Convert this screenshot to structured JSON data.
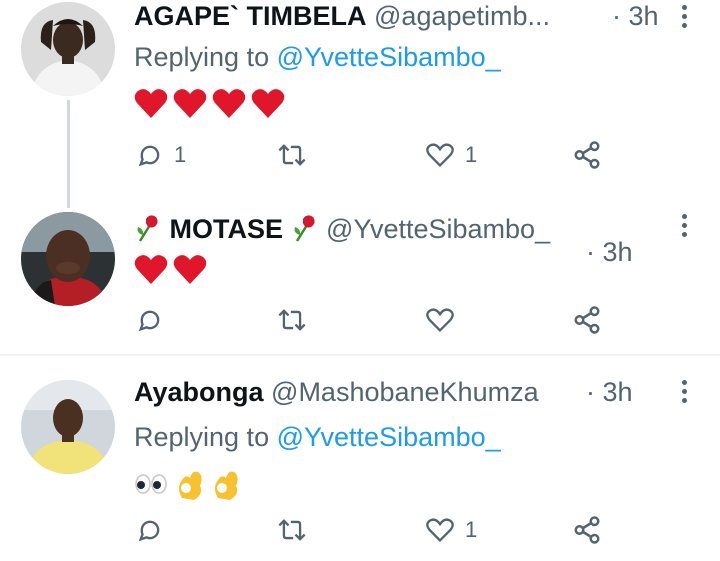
{
  "tweets": [
    {
      "display_name": "AGAPE` TIMBELA",
      "handle": "@agapetimb...",
      "time": "· 3h",
      "replying_label": "Replying to",
      "replying_to": "@YvetteSibambo_",
      "content_emoji": [
        "red-heart",
        "red-heart",
        "red-heart",
        "red-heart"
      ],
      "reply_count": "1",
      "retweet_count": "",
      "like_count": "1"
    },
    {
      "display_name": "MOTASE",
      "name_decoration": "rose",
      "handle": "@YvetteSibambo_",
      "time": "· 3h",
      "content_emoji": [
        "red-heart",
        "red-heart"
      ],
      "reply_count": "",
      "retweet_count": "",
      "like_count": ""
    },
    {
      "display_name": "Ayabonga",
      "handle": "@MashobaneKhumza",
      "time": "· 3h",
      "replying_label": "Replying to",
      "replying_to": "@YvetteSibambo_",
      "content_emoji": [
        "eyes",
        "ok-hand",
        "ok-hand"
      ],
      "reply_count": "",
      "retweet_count": "",
      "like_count": "1"
    }
  ],
  "colors": {
    "text": "#0f1419",
    "secondary": "#536471",
    "link": "#1d9bf0",
    "heart": "#e0162b",
    "thread_line": "#cfd9de"
  },
  "icons": [
    "reply-icon",
    "retweet-icon",
    "like-icon",
    "share-icon",
    "more-icon",
    "rose-icon"
  ]
}
